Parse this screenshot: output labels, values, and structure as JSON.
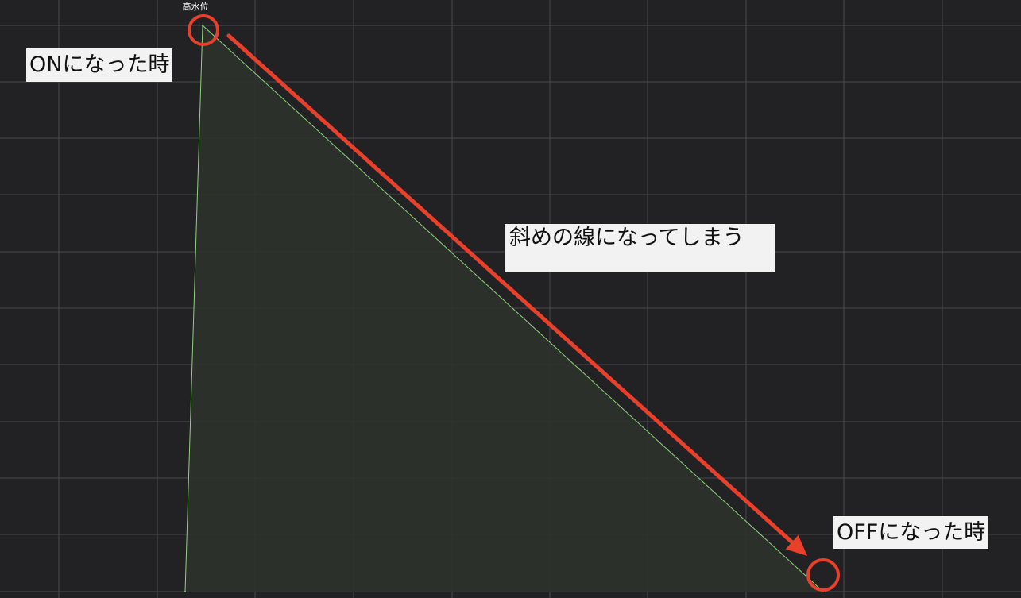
{
  "chart_data": {
    "type": "area",
    "series": [
      {
        "name": "高水位",
        "points": [
          {
            "x": 0,
            "y": 0
          },
          {
            "x": 1,
            "y": 1
          },
          {
            "x": 2,
            "y": 0
          }
        ]
      }
    ],
    "title": "",
    "xlabel": "",
    "ylabel": "",
    "grid": true,
    "legend": "none",
    "colors": {
      "background": "#222224",
      "grid": "#4a4a4e",
      "line": "#8fd07c",
      "fill": "#2d322c",
      "highlight": "#e8402a"
    },
    "annotations": {
      "on_label": "ONになった時",
      "slope_label": "斜めの線になってしまう",
      "off_label": "OFFになった時"
    }
  }
}
